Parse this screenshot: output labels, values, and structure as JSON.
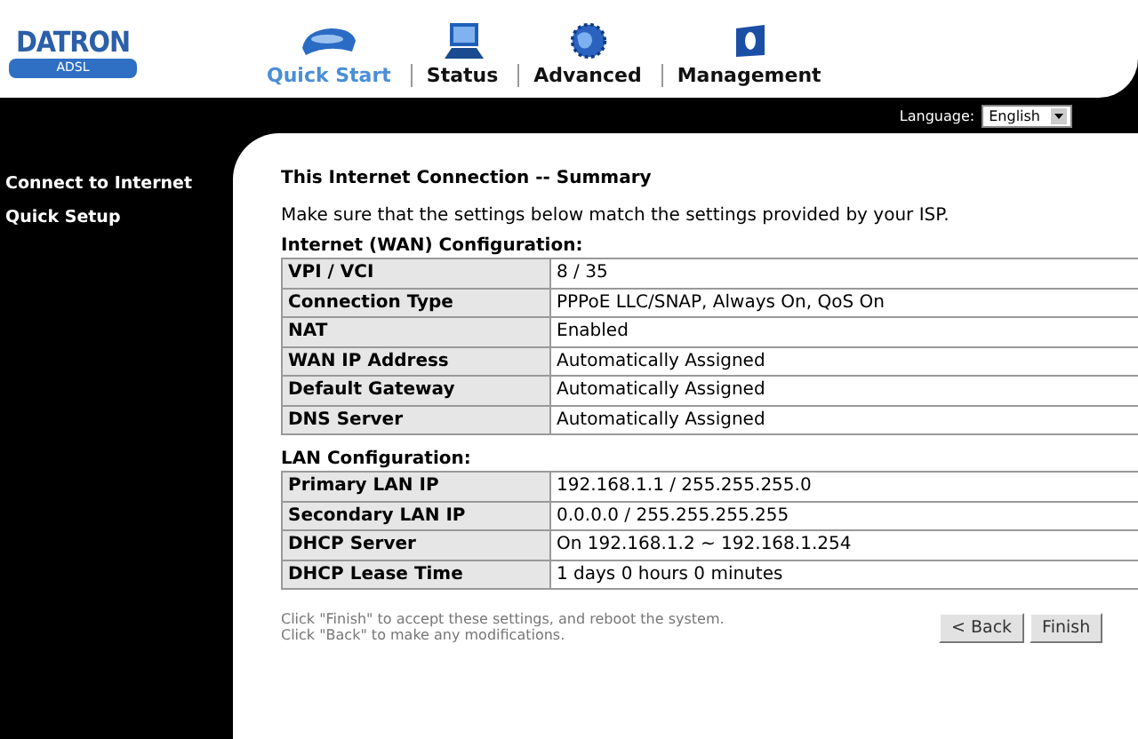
{
  "logo": {
    "name": "DATRON",
    "sub": "ADSL"
  },
  "nav": [
    {
      "label": "Quick Start",
      "selected": true
    },
    {
      "label": "Status",
      "selected": false
    },
    {
      "label": "Advanced",
      "selected": false
    },
    {
      "label": "Management",
      "selected": false
    }
  ],
  "language": {
    "label": "Language:",
    "value": "English"
  },
  "sidebar": {
    "items": [
      {
        "label": "Connect to Internet"
      },
      {
        "label": "Quick Setup"
      }
    ]
  },
  "title": "This Internet Connection -- Summary",
  "intro": "Make sure that the settings below match the settings provided by your ISP.",
  "sections": [
    {
      "heading": "Internet (WAN) Configuration:",
      "rows": [
        {
          "label": "VPI / VCI",
          "value": "8 / 35"
        },
        {
          "label": "Connection Type",
          "value": "PPPoE LLC/SNAP, Always On, QoS On"
        },
        {
          "label": "NAT",
          "value": "Enabled"
        },
        {
          "label": "WAN IP Address",
          "value": "Automatically Assigned"
        },
        {
          "label": "Default Gateway",
          "value": "Automatically Assigned"
        },
        {
          "label": "DNS Server",
          "value": "Automatically Assigned"
        }
      ]
    },
    {
      "heading": "LAN Configuration:",
      "rows": [
        {
          "label": "Primary LAN IP",
          "value": "192.168.1.1 / 255.255.255.0"
        },
        {
          "label": "Secondary LAN IP",
          "value": "0.0.0.0 / 255.255.255.255"
        },
        {
          "label": "DHCP Server",
          "value": "On 192.168.1.2 ~ 192.168.1.254"
        },
        {
          "label": "DHCP Lease Time",
          "value": "1 days 0 hours 0 minutes"
        }
      ]
    }
  ],
  "notes": [
    "Click \"Finish\" to accept these settings, and reboot the system.",
    "Click \"Back\" to make any modifications."
  ],
  "buttons": [
    "< Back",
    "Finish"
  ]
}
